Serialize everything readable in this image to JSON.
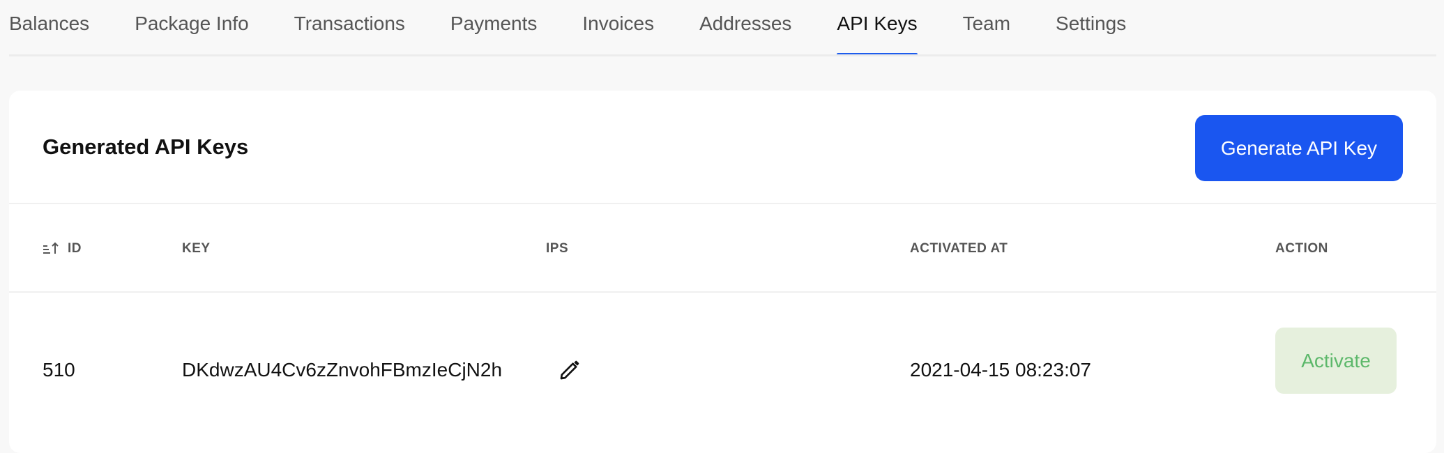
{
  "tabs": [
    {
      "label": "Balances",
      "active": false
    },
    {
      "label": "Package Info",
      "active": false
    },
    {
      "label": "Transactions",
      "active": false
    },
    {
      "label": "Payments",
      "active": false
    },
    {
      "label": "Invoices",
      "active": false
    },
    {
      "label": "Addresses",
      "active": false
    },
    {
      "label": "API Keys",
      "active": true
    },
    {
      "label": "Team",
      "active": false
    },
    {
      "label": "Settings",
      "active": false
    }
  ],
  "card": {
    "title": "Generated API Keys",
    "generate_button_label": "Generate API Key"
  },
  "table": {
    "columns": [
      "ID",
      "KEY",
      "IPS",
      "ACTIVATED AT",
      "ACTION"
    ],
    "sort_icon": "sort-ascending-icon",
    "rows": [
      {
        "id": "510",
        "key": "DKdwzAU4Cv6zZnvohFBmzIeCjN2h",
        "ips_icon": "pencil-edit-icon",
        "activated_at": "2021-04-15 08:23:07",
        "action_label": "Activate"
      }
    ]
  },
  "colors": {
    "accent": "#1a56f0",
    "activate_bg": "#e6f0dd",
    "activate_text": "#5cb86a"
  }
}
